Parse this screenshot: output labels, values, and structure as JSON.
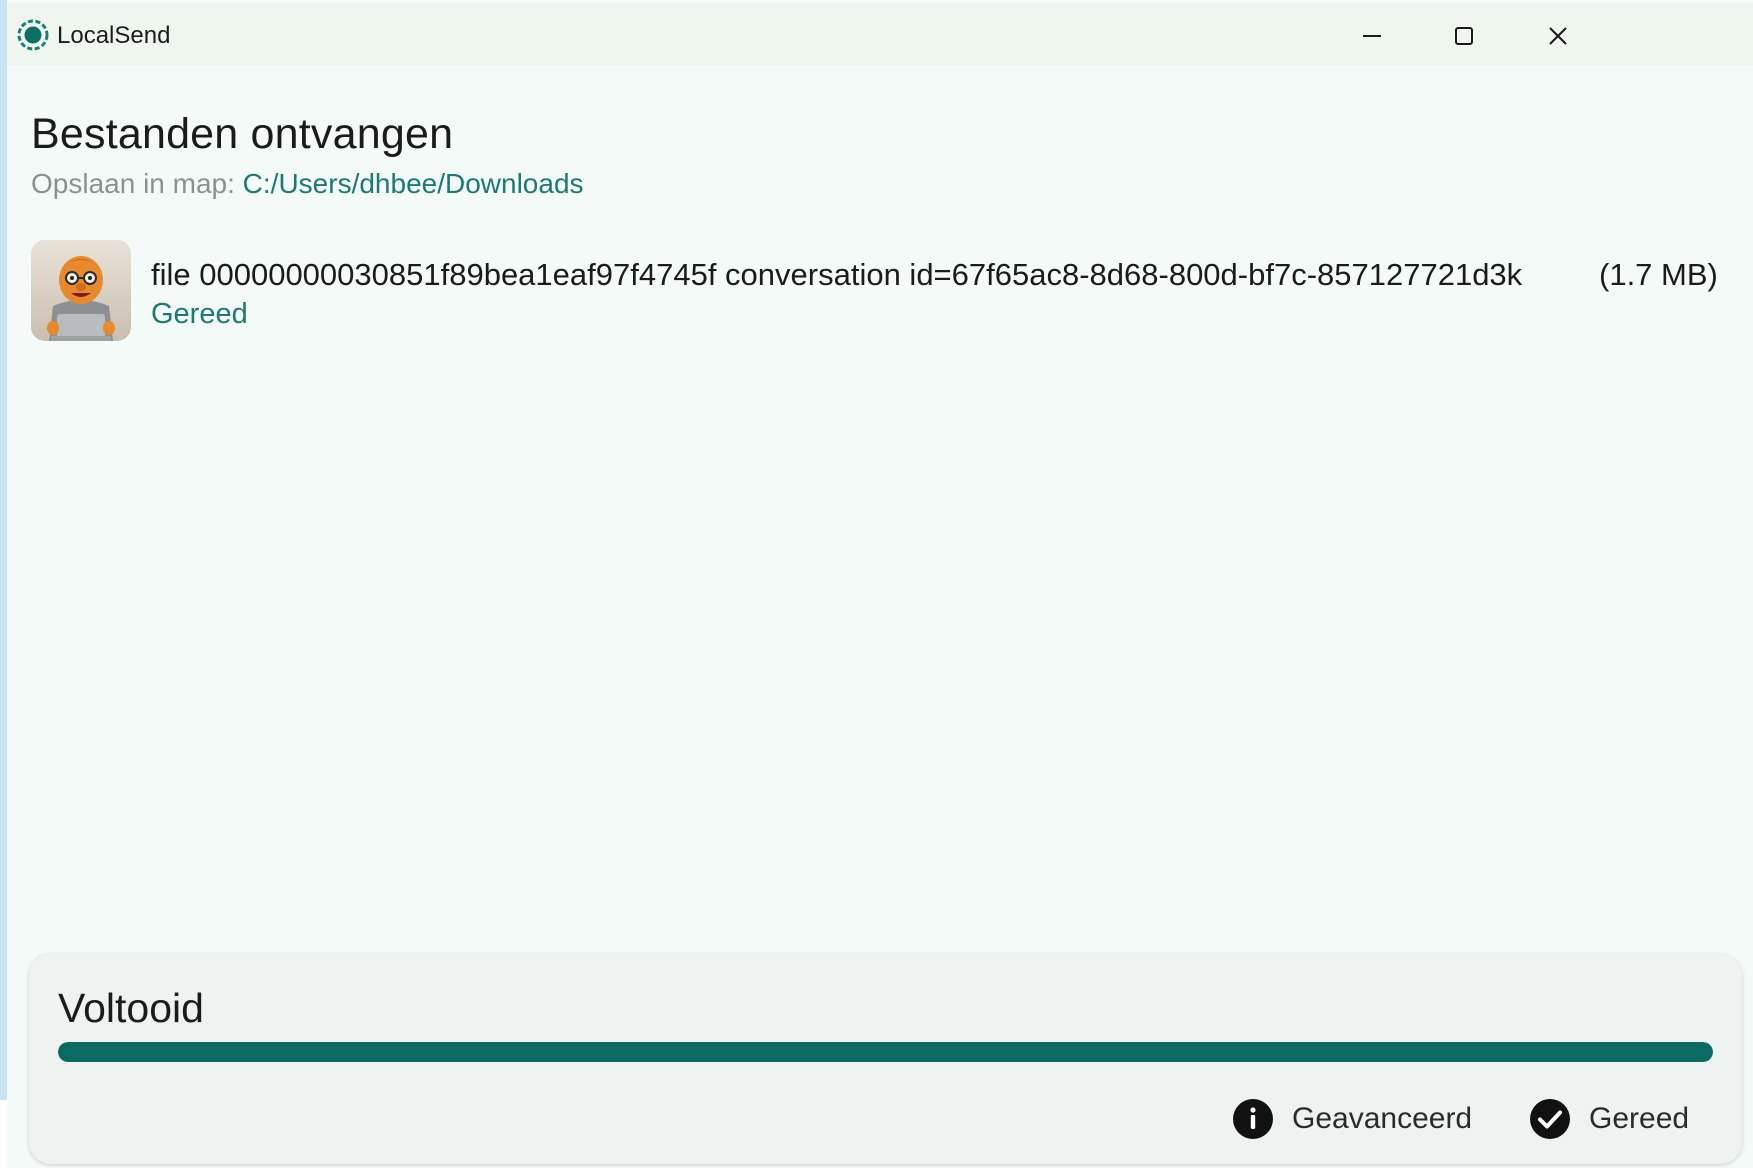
{
  "window": {
    "title": "LocalSend",
    "controls": [
      "minimize-icon",
      "maximize-icon",
      "close-icon"
    ]
  },
  "page": {
    "title": "Bestanden ontvangen",
    "save_label": "Opslaan in map:",
    "save_path": "C:/Users/dhbee/Downloads"
  },
  "files": [
    {
      "name": "file_00000000030851f89bea1eaf97f4745f_conversation_id=67f65ac8-8d68-800d-bf7c-857127721d3",
      "display_name": "file  00000000030851f89bea1eaf97f4745f  conversation  id=67f65ac8-8d68-800d-bf7c-857127721d3k",
      "size": "(1.7 MB)",
      "status": "Gereed"
    }
  ],
  "progress": {
    "title": "Voltooid",
    "fraction": 1.0
  },
  "actions": {
    "advanced_label": "Geavanceerd",
    "done_label": "Gereed"
  },
  "colors": {
    "accent": "#0b6b62",
    "link": "#1d7a72",
    "background": "#f3faf8"
  }
}
